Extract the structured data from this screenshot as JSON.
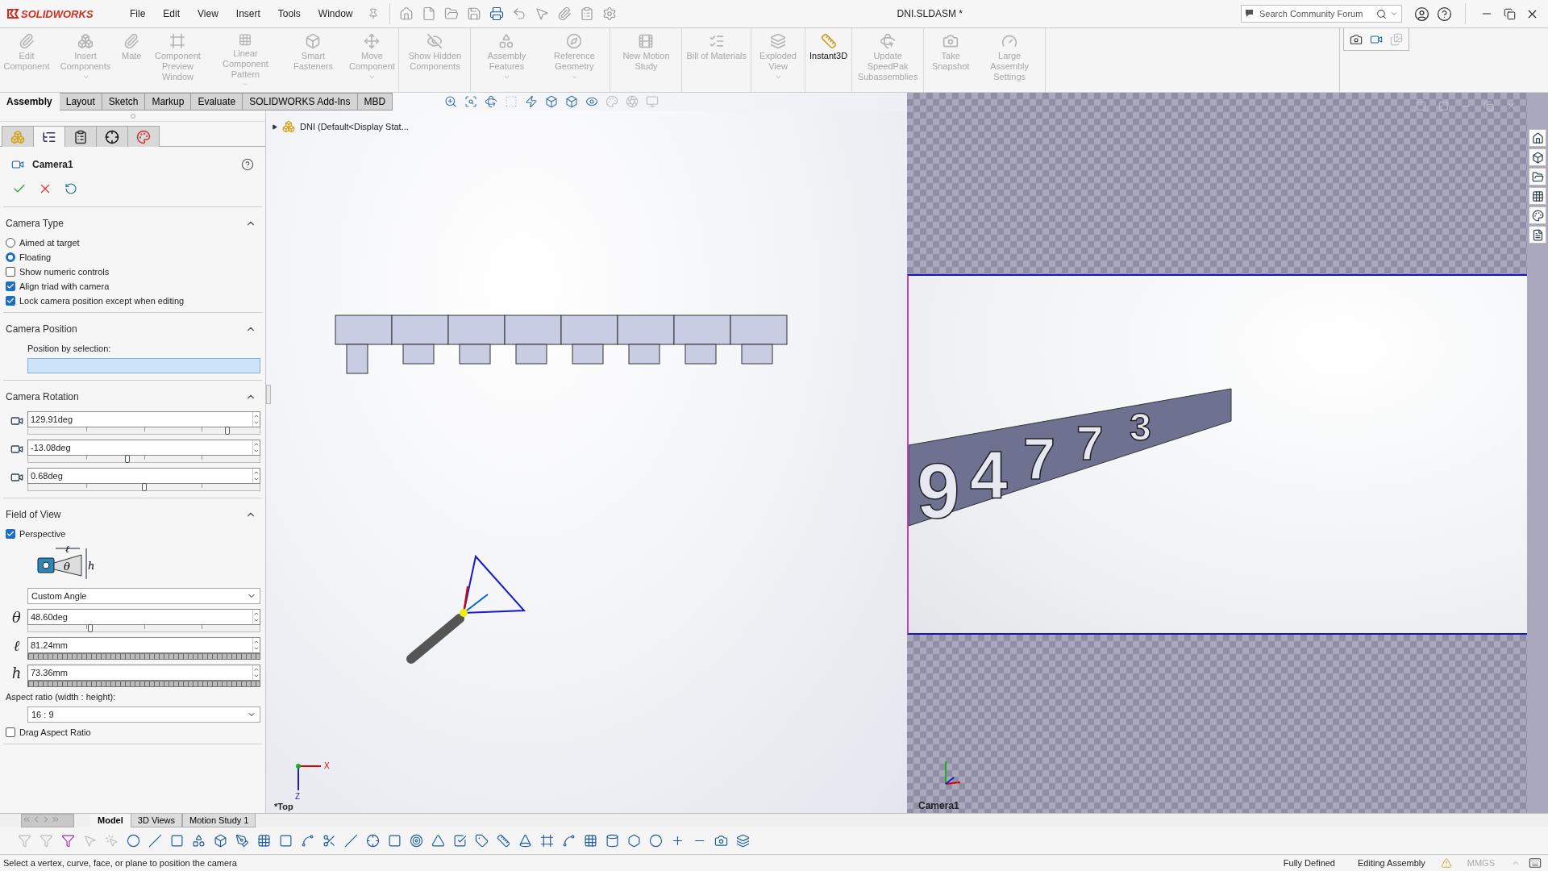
{
  "app": {
    "logo": "SOLIDWORKS",
    "menu": [
      "File",
      "Edit",
      "View",
      "Insert",
      "Tools",
      "Window"
    ],
    "document_title": "DNI.SLDASM *",
    "search": {
      "placeholder": "Search Community Forum"
    }
  },
  "command_groups": [
    [
      {
        "label": "Edit Component",
        "disabled": true,
        "dropdown": false
      },
      {
        "label": "Insert Components",
        "disabled": true,
        "dropdown": true
      },
      {
        "label": "Mate",
        "disabled": true,
        "dropdown": false
      },
      {
        "label": "Component Preview Window",
        "disabled": true,
        "dropdown": false
      },
      {
        "label": "Linear Component Pattern",
        "disabled": true,
        "dropdown": true
      },
      {
        "label": "Smart Fasteners",
        "disabled": true,
        "dropdown": false
      },
      {
        "label": "Move Component",
        "disabled": true,
        "dropdown": true
      }
    ],
    [
      {
        "label": "Show Hidden Components",
        "disabled": true,
        "dropdown": false
      }
    ],
    [
      {
        "label": "Assembly Features",
        "disabled": true,
        "dropdown": true
      },
      {
        "label": "Reference Geometry",
        "disabled": true,
        "dropdown": true
      }
    ],
    [
      {
        "label": "New Motion Study",
        "disabled": true,
        "dropdown": false
      }
    ],
    [
      {
        "label": "Bill of Materials",
        "disabled": true,
        "dropdown": false
      }
    ],
    [
      {
        "label": "Exploded View",
        "disabled": true,
        "dropdown": true
      }
    ],
    [
      {
        "label": "Instant3D",
        "disabled": false,
        "dropdown": false
      }
    ],
    [
      {
        "label": "Update SpeedPak Subassemblies",
        "disabled": true,
        "dropdown": false
      }
    ],
    [
      {
        "label": "Take Snapshot",
        "disabled": true,
        "dropdown": false
      },
      {
        "label": "Large Assembly Settings",
        "disabled": true,
        "dropdown": false
      }
    ]
  ],
  "tabs": [
    {
      "label": "Assembly",
      "selected": true
    },
    {
      "label": "Layout",
      "selected": false
    },
    {
      "label": "Sketch",
      "selected": false
    },
    {
      "label": "Markup",
      "selected": false
    },
    {
      "label": "Evaluate",
      "selected": false
    },
    {
      "label": "SOLIDWORKS Add-Ins",
      "selected": false
    },
    {
      "label": "MBD",
      "selected": false
    }
  ],
  "panel_tabs": [
    {
      "kind": "feature",
      "selected": false
    },
    {
      "kind": "property",
      "selected": true
    },
    {
      "kind": "configuration",
      "selected": false
    },
    {
      "kind": "dimxpert",
      "selected": false
    },
    {
      "kind": "display",
      "selected": false
    }
  ],
  "property_manager": {
    "title": "Camera1",
    "sections": [
      {
        "title": "Camera Type",
        "expanded": true,
        "items": [
          {
            "kind": "radio",
            "label": "Aimed at target",
            "selected": false
          },
          {
            "kind": "radio",
            "label": "Floating",
            "selected": true
          },
          {
            "kind": "checkbox",
            "label": "Show numeric controls",
            "checked": false
          },
          {
            "kind": "checkbox",
            "label": "Align triad with camera",
            "checked": true
          },
          {
            "kind": "checkbox",
            "label": "Lock camera position except when editing",
            "checked": true
          }
        ]
      },
      {
        "title": "Camera Position",
        "expanded": true,
        "items": [
          {
            "kind": "label",
            "text": "Position by selection:"
          },
          {
            "kind": "selection",
            "active": true
          }
        ]
      },
      {
        "title": "Camera Rotation",
        "expanded": true,
        "items": [
          {
            "kind": "slider",
            "value": "129.91deg",
            "level": 0.86
          },
          {
            "kind": "slider",
            "value": "-13.08deg",
            "level": 0.43
          },
          {
            "kind": "slider",
            "value": "0.68deg",
            "level": 0.5
          }
        ]
      },
      {
        "title": "Field of View",
        "expanded": true,
        "items": [
          {
            "kind": "checkbox",
            "label": "Perspective",
            "checked": true
          },
          {
            "kind": "diagram",
            "labels": [
              "ℓ",
              "θ",
              "h"
            ]
          },
          {
            "kind": "select",
            "value": "Custom Angle"
          },
          {
            "kind": "slider",
            "symbol": "θ",
            "value": "48.60deg",
            "level": 0.27
          },
          {
            "kind": "thumbwheel",
            "symbol": "ℓ",
            "value": "81.24mm"
          },
          {
            "kind": "thumbwheel",
            "symbol": "h",
            "value": "73.36mm"
          },
          {
            "kind": "label",
            "text": "Aspect ratio (width : height):"
          },
          {
            "kind": "select",
            "value": "16 : 9"
          },
          {
            "kind": "checkbox",
            "label": "Drag Aspect Ratio",
            "checked": false
          }
        ]
      }
    ]
  },
  "feature_tree": {
    "label": "DNI  (Default<Display Stat...",
    "expanded": false
  },
  "viewport": {
    "view_label": "*Top",
    "triad_labels": [
      "X",
      "Z"
    ]
  },
  "camera_view": {
    "label": "Camera1",
    "model_digits": [
      "9",
      "4",
      "7",
      "7",
      "3"
    ]
  },
  "bottom_tabs": [
    {
      "label": "Model",
      "selected": true
    },
    {
      "label": "3D Views",
      "selected": false
    },
    {
      "label": "Motion Study 1",
      "selected": false
    }
  ],
  "status_bar": {
    "message": "Select a vertex, curve, face, or plane to position the camera",
    "state": "Fully Defined",
    "mode": "Editing Assembly",
    "units": "MMGS"
  }
}
